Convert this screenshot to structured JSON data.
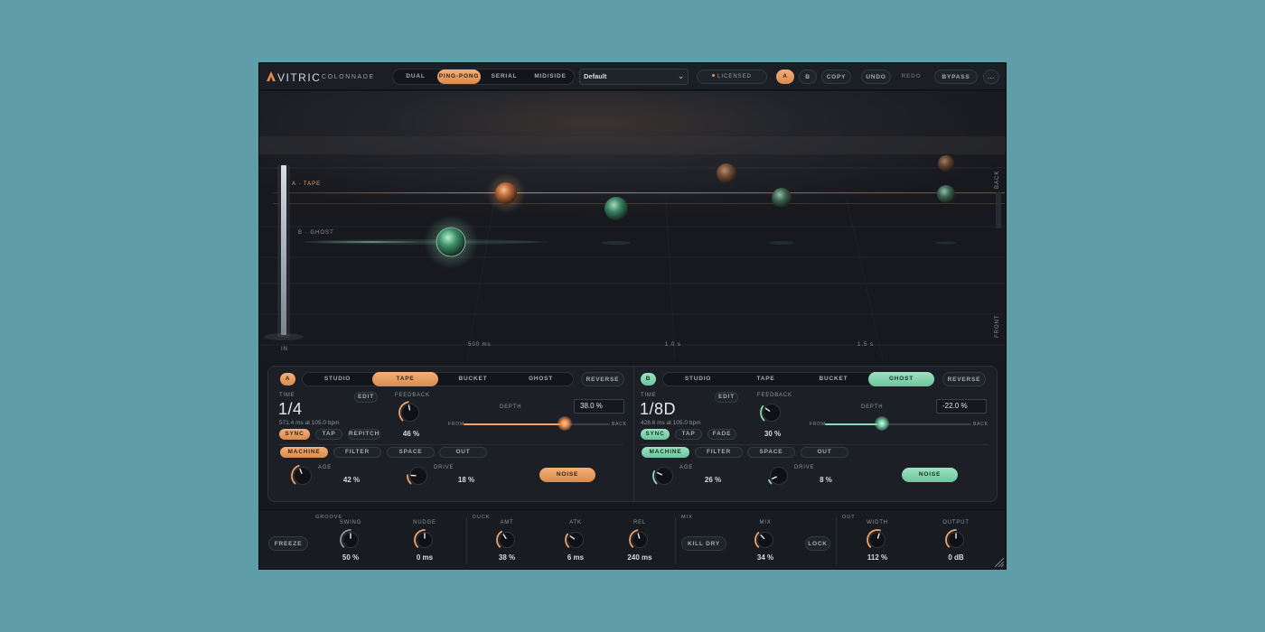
{
  "colors": {
    "accent_a": "#f0a46a",
    "accent_b": "#8fd9b6",
    "background": "#5f9ea8",
    "panel": "#15181d"
  },
  "header": {
    "brand": "VITRIC",
    "product": "COLONNADE",
    "routing_modes": [
      "DUAL",
      "PING-PONG",
      "SERIAL",
      "MID/SIDE"
    ],
    "routing_active": "PING-PONG",
    "preset": "Default",
    "license": "LICENSED",
    "ab_a": "A",
    "ab_b": "B",
    "copy": "COPY",
    "undo": "UNDO",
    "redo": "REDO",
    "bypass": "BYPASS",
    "more": "..."
  },
  "viz": {
    "line_a": "A · TAPE",
    "line_b": "B · GHOST",
    "in_label": "IN",
    "back_label": "BACK",
    "front_label": "FRONT",
    "ticks": [
      "500 ms",
      "1.0 s",
      "1.5 s"
    ]
  },
  "panel_a": {
    "badge": "A",
    "modes": [
      "STUDIO",
      "TAPE",
      "BUCKET",
      "GHOST"
    ],
    "active_mode": "TAPE",
    "reverse": "REVERSE",
    "time_label": "TIME",
    "edit": "EDIT",
    "time_value": "1/4",
    "time_info": "571.4 ms at 105.0 bpm",
    "feedback_label": "FEEDBACK",
    "feedback_value": "46 %",
    "feedback_level": 0.46,
    "depth_label": "DEPTH",
    "depth_value": "38.0 %",
    "depth_position": 0.69,
    "from_label": "FROM",
    "back_label": "BACK",
    "sync_buttons": [
      "SYNC",
      "TAP",
      "REPITCH"
    ],
    "tabs": [
      "MACHINE",
      "FILTER",
      "SPACE",
      "OUT"
    ],
    "age_label": "AGE",
    "age_value": "42 %",
    "age_level": 0.42,
    "drive_label": "DRIVE",
    "drive_value": "18 %",
    "drive_level": 0.18,
    "noise": "NOISE"
  },
  "panel_b": {
    "badge": "B",
    "modes": [
      "STUDIO",
      "TAPE",
      "BUCKET",
      "GHOST"
    ],
    "active_mode": "GHOST",
    "reverse": "REVERSE",
    "time_label": "TIME",
    "edit": "EDIT",
    "time_value": "1/8D",
    "time_info": "428.6 ms at 105.0 bpm",
    "feedback_label": "FEEDBACK",
    "feedback_value": "30 %",
    "feedback_level": 0.3,
    "depth_label": "DEPTH",
    "depth_value": "-22.0 %",
    "depth_position": 0.39,
    "from_label": "FROM",
    "back_label": "BACK",
    "sync_buttons": [
      "SYNC",
      "TAP",
      "FADE"
    ],
    "tabs": [
      "MACHINE",
      "FILTER",
      "SPACE",
      "OUT"
    ],
    "age_label": "AGE",
    "age_value": "26 %",
    "age_level": 0.26,
    "drive_label": "DRIVE",
    "drive_value": "8 %",
    "drive_level": 0.08,
    "noise": "NOISE"
  },
  "bottom": {
    "groove_label": "GROOVE",
    "freeze": "FREEZE",
    "swing_label": "SWING",
    "swing_value": "50 %",
    "swing_level": 0.5,
    "nudge_label": "NUDGE",
    "nudge_value": "0 ms",
    "nudge_level": 0.5,
    "duck_label": "DUCK",
    "amt_label": "AMT",
    "amt_value": "38 %",
    "amt_level": 0.38,
    "atk_label": "ATK",
    "atk_value": "6 ms",
    "atk_level": 0.3,
    "rel_label": "REL",
    "rel_value": "240 ms",
    "rel_level": 0.45,
    "mix_group_label": "MIX",
    "kill_dry": "KILL DRY",
    "mix_label": "MIX",
    "mix_value": "34 %",
    "mix_level": 0.34,
    "lock": "LOCK",
    "out_label": "OUT",
    "width_label": "WIDTH",
    "width_value": "112 %",
    "width_level": 0.56,
    "output_label": "OUTPUT",
    "output_value": "0 dB",
    "output_level": 0.5
  }
}
